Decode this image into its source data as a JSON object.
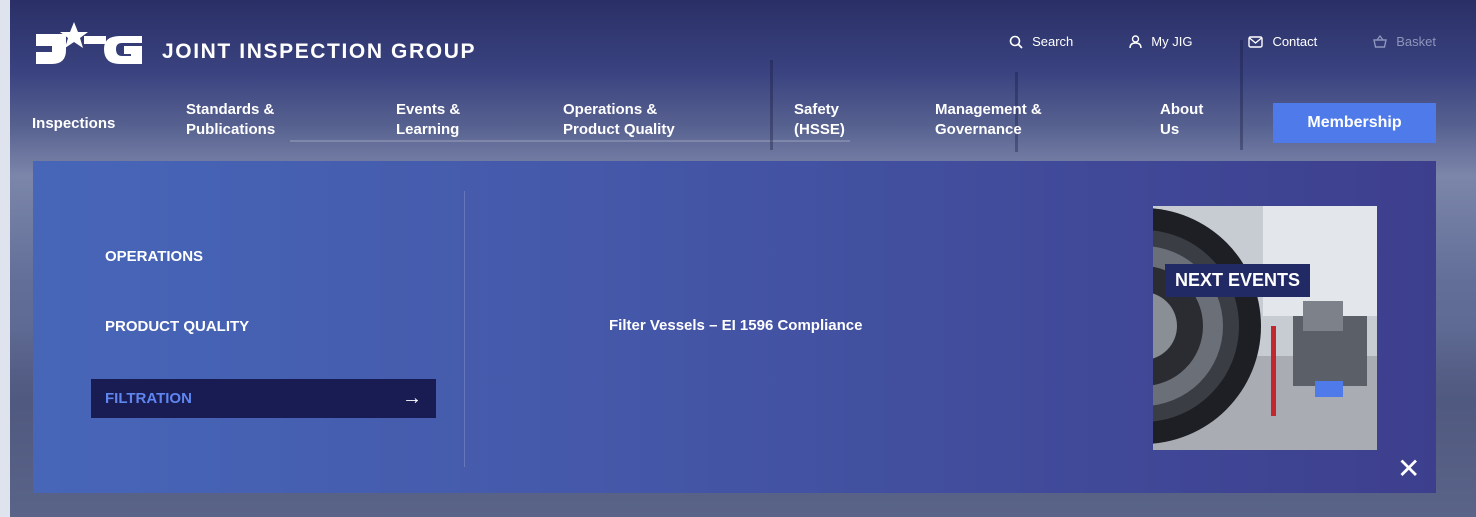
{
  "brand": {
    "logo_text": "JIG",
    "name": "JOINT INSPECTION GROUP"
  },
  "utility": {
    "search": "Search",
    "my_jig": "My JIG",
    "contact": "Contact",
    "basket": "Basket"
  },
  "nav": {
    "items": [
      {
        "label": "Inspections"
      },
      {
        "label": "Standards &\nPublications"
      },
      {
        "label": "Events &\nLearning"
      },
      {
        "label": "Operations &\nProduct Quality"
      },
      {
        "label": "Safety\n(HSSE)"
      },
      {
        "label": "Management &\nGovernance"
      },
      {
        "label": "About\nUs"
      }
    ],
    "membership": "Membership"
  },
  "menu": {
    "categories": [
      {
        "label": "OPERATIONS"
      },
      {
        "label": "PRODUCT QUALITY"
      },
      {
        "label": "FILTRATION",
        "active": true
      }
    ],
    "active_arrow": "→",
    "sub_links": [
      {
        "label": "Filter Vessels – EI 1596 Compliance"
      }
    ],
    "promo_label": "NEXT EVENTS",
    "close": "✕"
  },
  "colors": {
    "accent": "#4f7bea",
    "panel": "#4558a9",
    "active_bg": "#191c53",
    "active_text": "#5f86f0"
  }
}
